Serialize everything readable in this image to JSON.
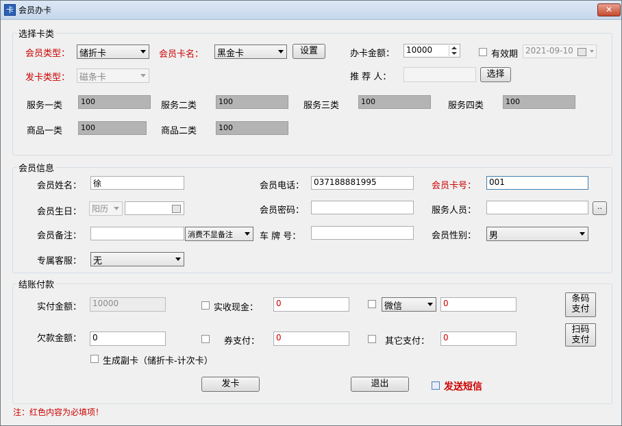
{
  "window": {
    "title": "会员办卡",
    "close": "✕"
  },
  "card_section": {
    "legend": "选择卡类",
    "member_type": {
      "label": "会员类型：",
      "value": "储折卡"
    },
    "card_name": {
      "label": "会员卡名：",
      "value": "黑金卡"
    },
    "settings_button": "设置",
    "amount": {
      "label": "办卡金额：",
      "value": "10000"
    },
    "validity": {
      "label": "有效期",
      "value": "2021-09-10"
    },
    "issue_type": {
      "label": "发卡类型：",
      "value": "磁条卡"
    },
    "referrer": {
      "label": "推 荐 人：",
      "value": ""
    },
    "select_button": "选择",
    "services": [
      {
        "label": "服务一类",
        "value": "100"
      },
      {
        "label": "服务二类",
        "value": "100"
      },
      {
        "label": "服务三类",
        "value": "100"
      },
      {
        "label": "服务四类",
        "value": "100"
      },
      {
        "label": "商品一类",
        "value": "100"
      },
      {
        "label": "商品二类",
        "value": "100"
      }
    ]
  },
  "member_section": {
    "legend": "会员信息",
    "name": {
      "label": "会员姓名：",
      "value": "徐"
    },
    "phone": {
      "label": "会员电话：",
      "value": "037188881995"
    },
    "card_no": {
      "label": "会员卡号：",
      "value": "001"
    },
    "birthday": {
      "label": "会员生日：",
      "calendar": "阳历",
      "value": ""
    },
    "password": {
      "label": "会员密码：",
      "value": ""
    },
    "staff": {
      "label": "服务人员：",
      "value": "",
      "button": ".."
    },
    "remark": {
      "label": "会员备注：",
      "value": "",
      "option": "消费不显备注"
    },
    "plate": {
      "label": "车 牌 号：",
      "value": ""
    },
    "gender": {
      "label": "会员性别：",
      "value": "男"
    },
    "service_rep": {
      "label": "专属客服：",
      "value": "无"
    }
  },
  "payment_section": {
    "legend": "结账付款",
    "paid": {
      "label": "实付金额：",
      "value": "10000"
    },
    "cash": {
      "label": "实收现金：",
      "value": "0"
    },
    "wechat": {
      "option": "微信",
      "value": "0"
    },
    "barcode_button": [
      "条码",
      "支付"
    ],
    "debt": {
      "label": "欠款金额：",
      "value": "0"
    },
    "coupon": {
      "label": "券支付：",
      "value": "0"
    },
    "other": {
      "label": "其它支付：",
      "value": "0"
    },
    "scan_button": [
      "扫码",
      "支付"
    ],
    "sub_card": {
      "label": "生成副卡（储折卡-计次卡）"
    },
    "issue_button": "发卡",
    "exit_button": "退出",
    "sms": {
      "label": "发送短信"
    }
  },
  "footer_note": "注：红色内容为必填项！",
  "colors": {
    "required": "#cc0000",
    "sms": "#cc0000"
  }
}
